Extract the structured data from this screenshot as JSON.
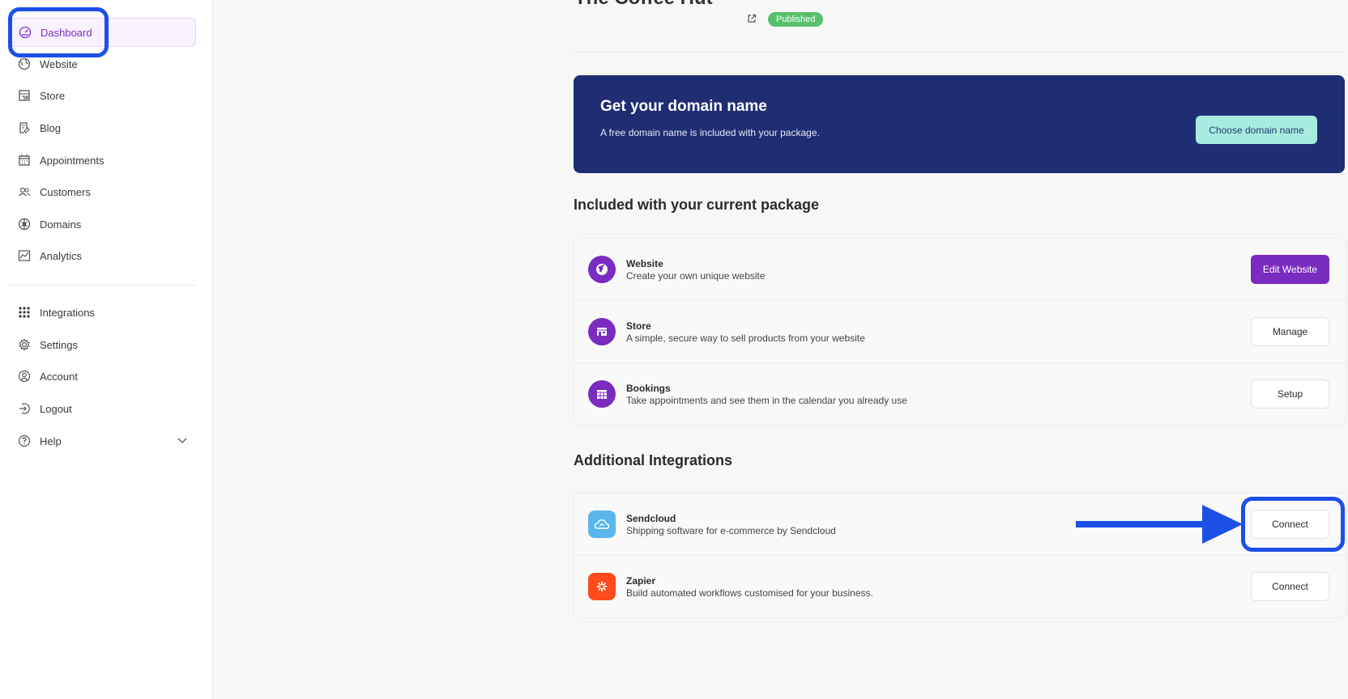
{
  "sidebar": {
    "items": [
      {
        "label": "Dashboard",
        "icon": "dashboard-icon"
      },
      {
        "label": "Website",
        "icon": "globe-icon"
      },
      {
        "label": "Store",
        "icon": "store-icon"
      },
      {
        "label": "Blog",
        "icon": "blog-icon"
      },
      {
        "label": "Appointments",
        "icon": "calendar-icon"
      },
      {
        "label": "Customers",
        "icon": "users-icon"
      },
      {
        "label": "Domains",
        "icon": "domains-icon"
      },
      {
        "label": "Analytics",
        "icon": "analytics-icon"
      }
    ],
    "secondary": [
      {
        "label": "Integrations",
        "icon": "grid-icon"
      },
      {
        "label": "Settings",
        "icon": "gear-icon"
      },
      {
        "label": "Account",
        "icon": "account-icon"
      },
      {
        "label": "Logout",
        "icon": "logout-icon"
      },
      {
        "label": "Help",
        "icon": "help-icon"
      }
    ]
  },
  "header": {
    "site_title": "The Coffee Hut",
    "status_badge": "Published"
  },
  "domain_card": {
    "title": "Get your domain name",
    "subtitle": "A free domain name is included with your package.",
    "button": "Choose domain name"
  },
  "included": {
    "title": "Included with your current package",
    "rows": [
      {
        "name": "Website",
        "desc": "Create your own unique website",
        "button": "Edit Website",
        "icon": "globe-icon"
      },
      {
        "name": "Store",
        "desc": "A simple, secure way to sell products from your website",
        "button": "Manage",
        "icon": "store-icon"
      },
      {
        "name": "Bookings",
        "desc": "Take appointments and see them in the calendar you already use",
        "button": "Setup",
        "icon": "calendar-icon"
      }
    ]
  },
  "integrations": {
    "title": "Additional Integrations",
    "rows": [
      {
        "name": "Sendcloud",
        "desc": "Shipping software for e-commerce by Sendcloud",
        "button": "Connect",
        "icon": "cloud-icon"
      },
      {
        "name": "Zapier",
        "desc": "Build automated workflows customised for your business.",
        "button": "Connect",
        "icon": "zapier-icon"
      }
    ]
  },
  "colors": {
    "accent": "#7a2bc0",
    "domain_card": "#1f2e73",
    "domain_button": "#a8ece1",
    "annotation": "#1c4fe6",
    "published": "#58c06a"
  }
}
